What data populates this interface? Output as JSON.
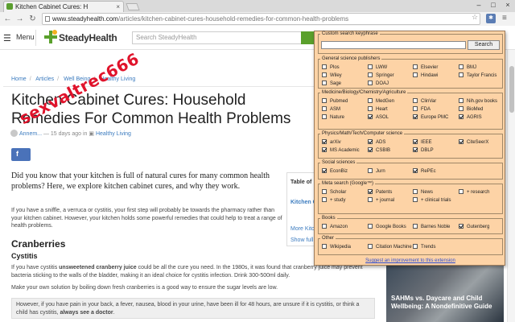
{
  "browser": {
    "tab_title": "Kitchen Cabinet Cures: H",
    "tab_close": "×",
    "window": {
      "minimize": "–",
      "maximize": "□",
      "close": "×"
    },
    "nav": {
      "back": "←",
      "forward": "→",
      "reload": "↻"
    },
    "url_host": "www.steadyhealth.com",
    "url_path": "/articles/kitchen-cabinet-cures-household-remedies-for-common-health-problems",
    "star": "☆",
    "ext_icon": "ext-icon",
    "menu": "≡"
  },
  "site": {
    "menu_icon": "☰",
    "menu_label": "Menu",
    "logo": "SteadyHealth",
    "search_placeholder": "Search SteadyHealth"
  },
  "breadcrumb": [
    "Home",
    "Articles",
    "Well Being",
    "Healthy Living"
  ],
  "article": {
    "title": "Kitchen Cabinet Cures: Household Remedies For Common Health Problems",
    "author": "Annem...",
    "byline_mid": "—  15 days ago in",
    "category": "Healthy Living",
    "lead": "Did you know that your kitchen is full of natural cures for many common health problems? Here, we explore kitchen cabinet cures, and why they work.",
    "intro": "If you have a sniffle, a verruca or cystitis, your first step will probably be towards the pharmacy rather than your kitchen cabinet. However, your kitchen holds some powerful remedies that could help to treat a range of health problems.",
    "h_cranberries": "Cranberries",
    "h_cystitis": "Cystitis",
    "cyst_p1_pre": "If you have cystitis ",
    "cyst_p1_bold": "unsweetened cranberry juice",
    "cyst_p1_post": " could be all the cure you need. In the 1980s, it was found that cranberry juice may prevent bacteria sticking to the walls of the bladder, making it an ideal choice for cystitis infection. Drink 300-500ml daily.",
    "cyst_p2": "Make your own solution by boiling down fresh cranberries is a good way to ensure the sugar levels are low.",
    "callout_pre": "However, if you have pain in your back, a fever, nausea, blood in your urine, have been ill for 48 hours, are unsure if it is cystitis, or think a child has cystitis, ",
    "callout_bold": "always see a doctor",
    "callout_post": "."
  },
  "watermark": "sexvaltrec666",
  "toc": {
    "title": "Table of",
    "items": "Kitchen C... Common...",
    "more": "More Kitc...",
    "show": "Show full"
  },
  "ad": {
    "title": "SAHMs vs. Daycare and Child Wellbeing: A Nondefinitive Guide"
  },
  "popup": {
    "keyphrase_label": "Custom search keyphrase",
    "keyphrase_value": "",
    "search_button": "Search",
    "groups": [
      {
        "title": "General science publishers",
        "options": [
          {
            "label": "Plos",
            "on": false
          },
          {
            "label": "LWW",
            "on": false
          },
          {
            "label": "Elsevier",
            "on": false
          },
          {
            "label": "BMJ",
            "on": false
          },
          {
            "label": "Wiley",
            "on": false
          },
          {
            "label": "Springer",
            "on": false
          },
          {
            "label": "Hindawi",
            "on": false
          },
          {
            "label": "Taylor Francis",
            "on": false
          },
          {
            "label": "Sage",
            "on": false
          },
          {
            "label": "DOAJ",
            "on": false
          }
        ]
      },
      {
        "title": "Medicine/Biology/Chemistry/Agriculture",
        "options": [
          {
            "label": "Pubmed",
            "on": false
          },
          {
            "label": "MedGen",
            "on": false
          },
          {
            "label": "ClinVar",
            "on": false
          },
          {
            "label": "Nih.gov books",
            "on": false
          },
          {
            "label": "ASM",
            "on": false
          },
          {
            "label": "Heart",
            "on": false
          },
          {
            "label": "FDA",
            "on": false
          },
          {
            "label": "BioMed",
            "on": false
          },
          {
            "label": "Nature",
            "on": false
          },
          {
            "label": "ASOL",
            "on": true
          },
          {
            "label": "Europe PMC",
            "on": true
          },
          {
            "label": "AGRIS",
            "on": true
          }
        ]
      },
      {
        "title": "Physics/Math/Tech/Computer science",
        "options": [
          {
            "label": "arXiv",
            "on": true
          },
          {
            "label": "ADS",
            "on": true
          },
          {
            "label": "IEEE",
            "on": true
          },
          {
            "label": "CiteSeerX",
            "on": true
          },
          {
            "label": "MS Academic",
            "on": true
          },
          {
            "label": "CSBIB",
            "on": true
          },
          {
            "label": "DBLP",
            "on": true
          }
        ]
      },
      {
        "title": "Social sciences",
        "options": [
          {
            "label": "EconBiz",
            "on": true
          },
          {
            "label": "Jurn",
            "on": false
          },
          {
            "label": "RePEc",
            "on": true
          }
        ]
      },
      {
        "title": "Meta search (Google™)",
        "options": [
          {
            "label": "Scholar",
            "on": false
          },
          {
            "label": "Patents",
            "on": true
          },
          {
            "label": "News",
            "on": false
          },
          {
            "label": "+ research",
            "on": false
          },
          {
            "label": "+ study",
            "on": false
          },
          {
            "label": "+ journal",
            "on": false
          },
          {
            "label": "+ clinical trials",
            "on": false
          }
        ]
      },
      {
        "title": "Books",
        "options": [
          {
            "label": "Amazon",
            "on": false
          },
          {
            "label": "Google Books",
            "on": false
          },
          {
            "label": "Barnes Noble",
            "on": false
          },
          {
            "label": "Gutenberg",
            "on": true
          }
        ]
      },
      {
        "title": "Other",
        "options": [
          {
            "label": "Wikipedia",
            "on": false
          },
          {
            "label": "Citation Machine",
            "on": false
          },
          {
            "label": "Trends",
            "on": false
          }
        ]
      }
    ],
    "suggest": "Suggest an improvement to this extension"
  },
  "colors": {
    "popup_bg": "#fdd3a6",
    "link": "#3b7bbf",
    "watermark": "#e0132b",
    "brand_green": "#5aa02c"
  }
}
